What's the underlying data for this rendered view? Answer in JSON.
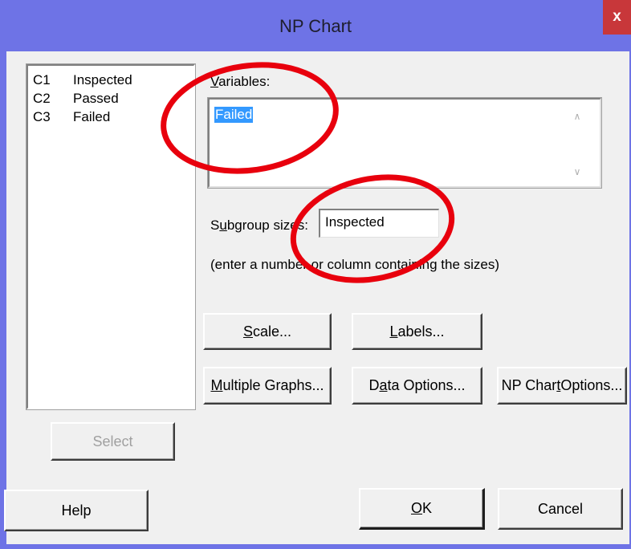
{
  "window": {
    "title": "NP Chart",
    "close_label": "x",
    "frame_color": "#6e73e6",
    "close_color": "#c8373a"
  },
  "columns": [
    {
      "id": "C1",
      "name": "Inspected"
    },
    {
      "id": "C2",
      "name": "Passed"
    },
    {
      "id": "C3",
      "name": "Failed"
    }
  ],
  "variables": {
    "label": "Variables:",
    "value": "Failed"
  },
  "subgroup": {
    "label": "Subgroup sizes:",
    "value": "Inspected",
    "hint": "(enter a number or column containing the sizes)"
  },
  "buttons": {
    "scale": "Scale...",
    "labels": "Labels...",
    "multiple_graphs": "Multiple Graphs...",
    "data_options": "Data Options...",
    "np_chart_options": "NP Chart Options...",
    "select": "Select",
    "help": "Help",
    "ok": "OK",
    "cancel": "Cancel"
  },
  "annotations": {
    "circle_color": "#e8000d",
    "count": 2
  }
}
